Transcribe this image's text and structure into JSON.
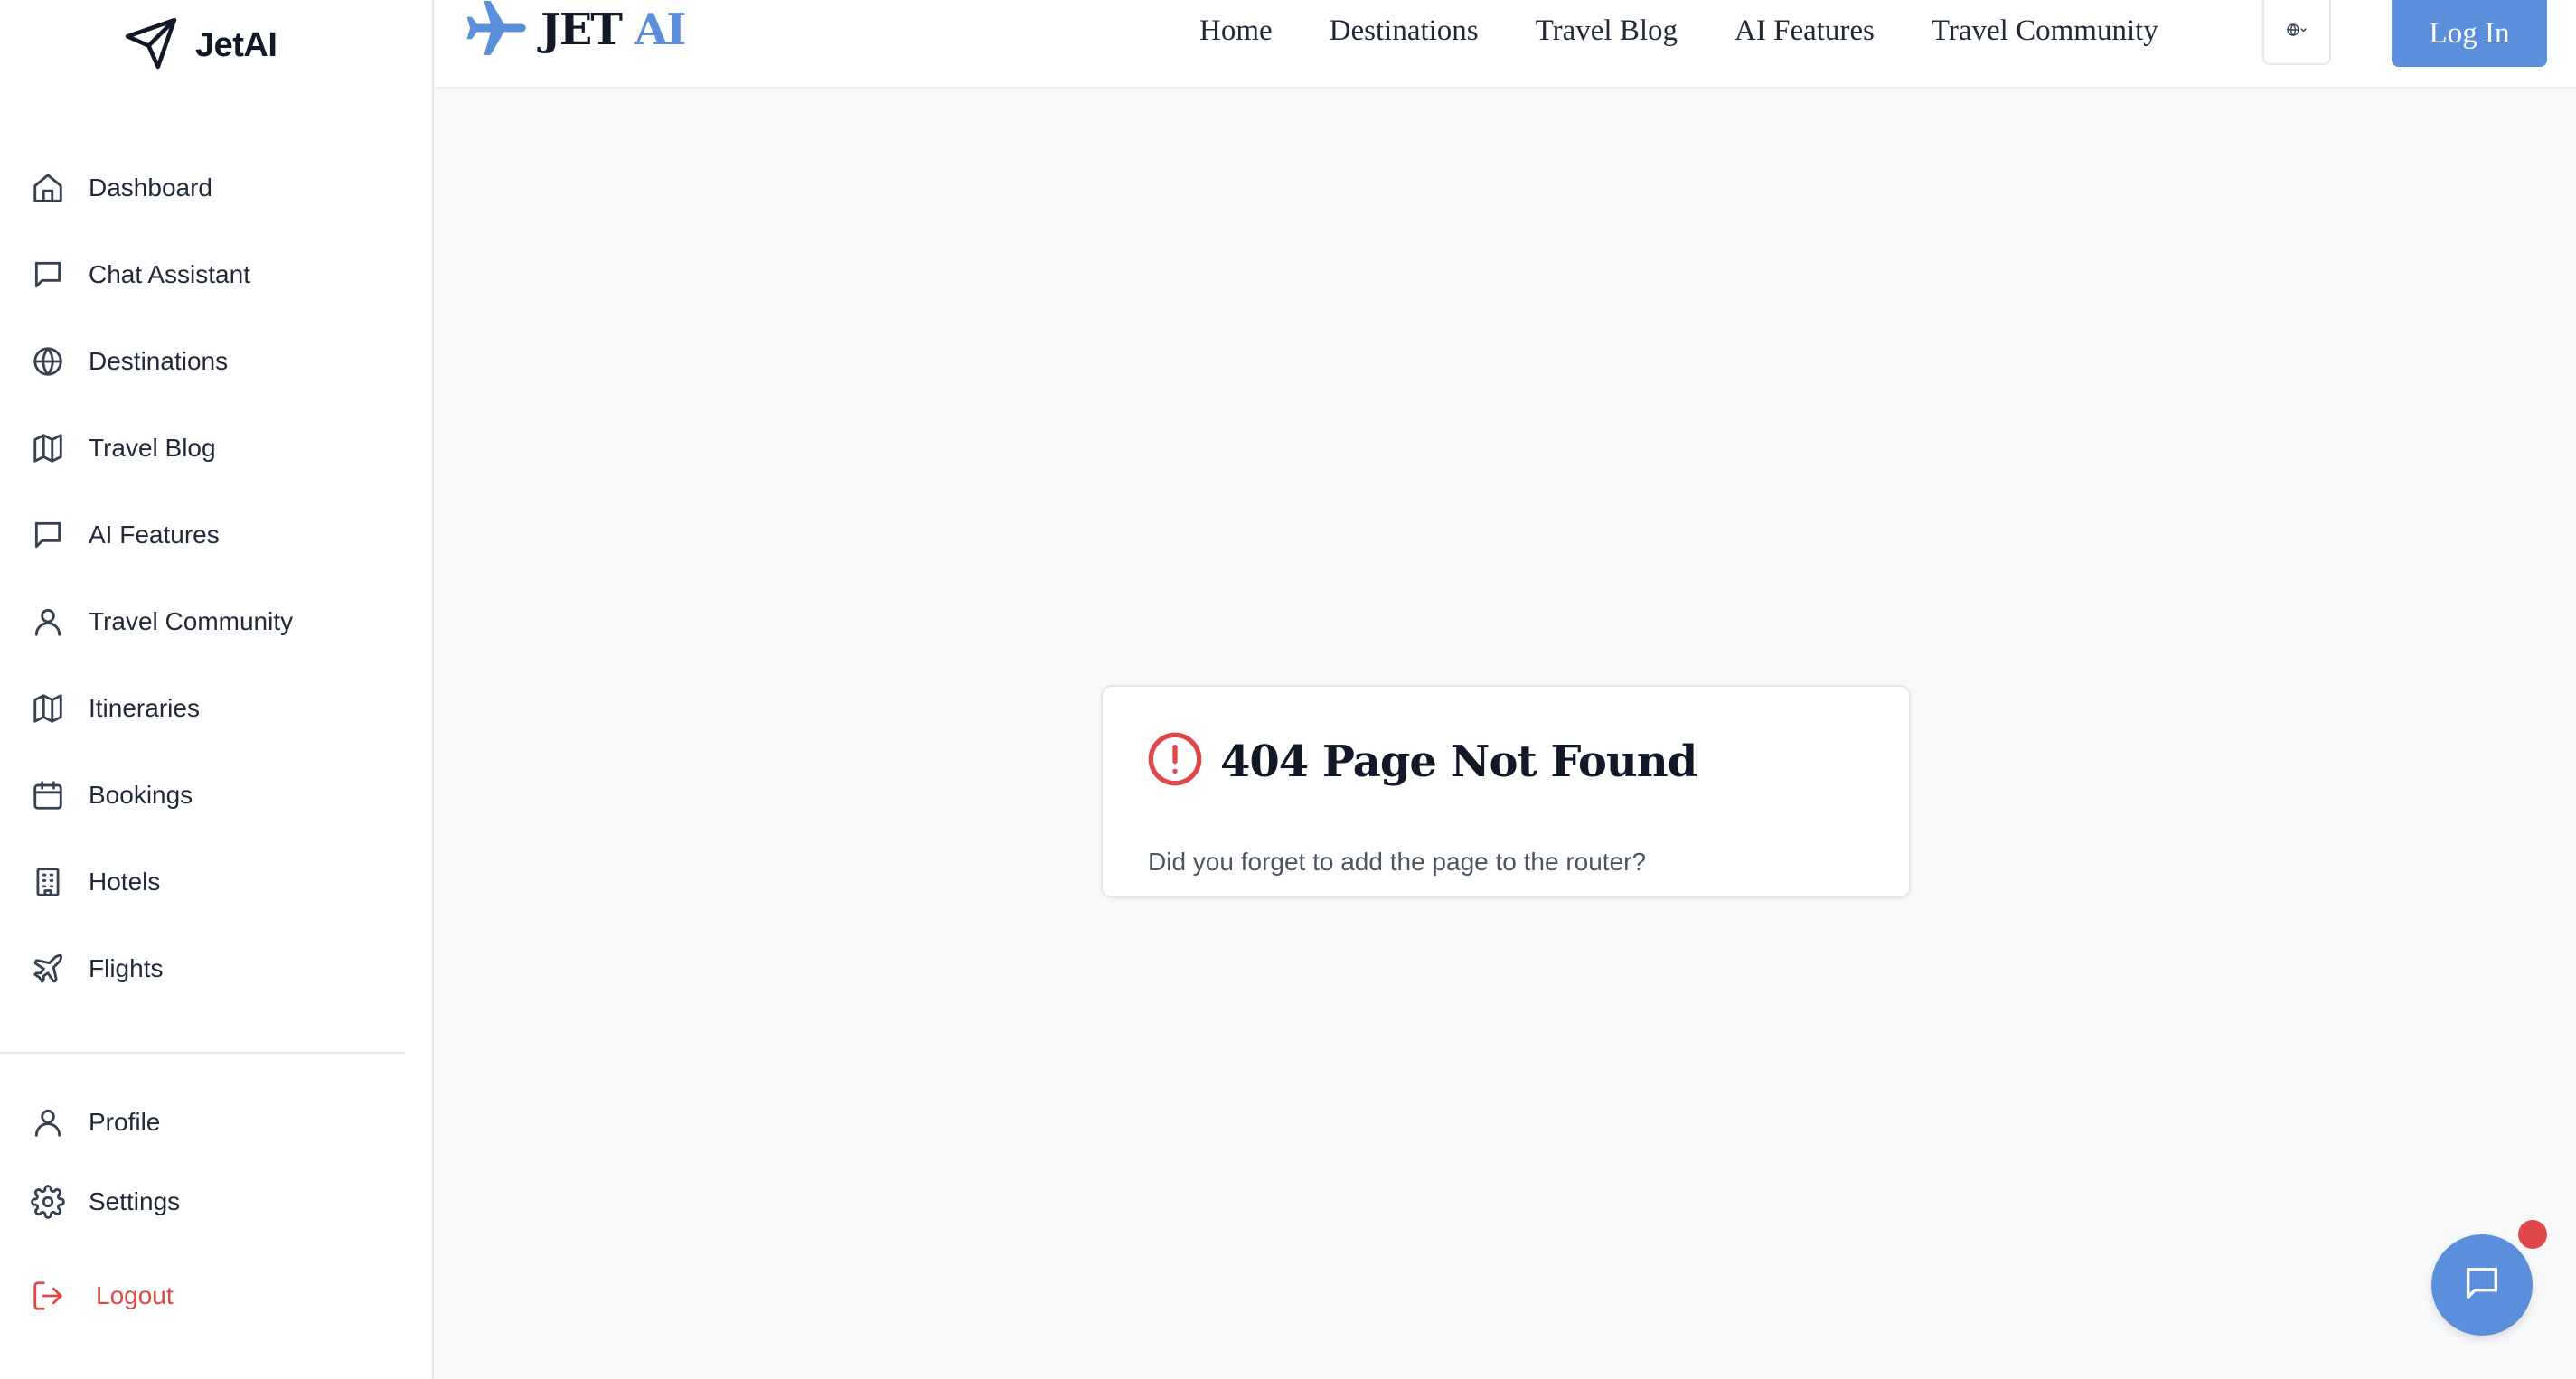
{
  "sidebar": {
    "brand": "JetAI",
    "items": [
      {
        "label": "Dashboard",
        "icon": "home-icon"
      },
      {
        "label": "Chat Assistant",
        "icon": "chat-icon"
      },
      {
        "label": "Destinations",
        "icon": "globe-icon"
      },
      {
        "label": "Travel Blog",
        "icon": "map-icon"
      },
      {
        "label": "AI Features",
        "icon": "chat-icon"
      },
      {
        "label": "Travel Community",
        "icon": "user-icon"
      },
      {
        "label": "Itineraries",
        "icon": "map-icon"
      },
      {
        "label": "Bookings",
        "icon": "calendar-icon"
      },
      {
        "label": "Hotels",
        "icon": "building-icon"
      },
      {
        "label": "Flights",
        "icon": "plane-icon"
      }
    ],
    "bottom": {
      "profile": "Profile",
      "settings": "Settings",
      "logout": "Logout"
    }
  },
  "header": {
    "logo_jet": "JET",
    "logo_ai": "AI",
    "nav": [
      "Home",
      "Destinations",
      "Travel Blog",
      "AI Features",
      "Travel Community"
    ],
    "login": "Log In"
  },
  "main": {
    "error_title": "404 Page Not Found",
    "error_message": "Did you forget to add the page to the router?"
  },
  "colors": {
    "accent": "#5b8fdc",
    "danger": "#e04848",
    "background": "#f8f9fb"
  }
}
